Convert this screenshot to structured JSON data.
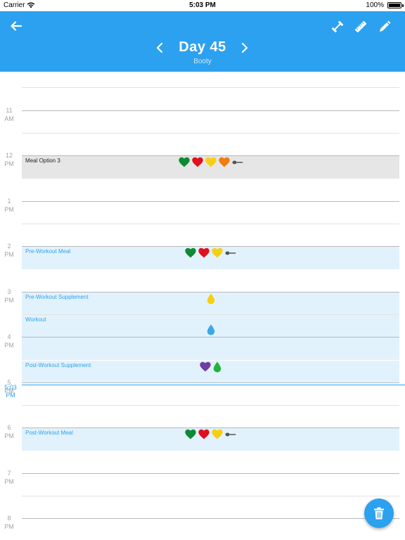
{
  "status_bar": {
    "carrier": "Carrier",
    "time": "5:03 PM",
    "battery": "100%"
  },
  "header": {
    "title": "Day 45",
    "subtitle": "Booty"
  },
  "timeline": {
    "hours": [
      {
        "num": "",
        "ampm": "AM"
      },
      {
        "num": "11",
        "ampm": "AM"
      },
      {
        "num": "12",
        "ampm": "PM"
      },
      {
        "num": "1",
        "ampm": "PM"
      },
      {
        "num": "2",
        "ampm": "PM"
      },
      {
        "num": "3",
        "ampm": "PM"
      },
      {
        "num": "4",
        "ampm": "PM"
      },
      {
        "num": "5",
        "ampm": "PM"
      },
      {
        "num": "6",
        "ampm": "PM"
      },
      {
        "num": "7",
        "ampm": "PM"
      },
      {
        "num": "8",
        "ampm": "PM"
      }
    ],
    "now": {
      "time": "5:03",
      "ampm": "PM"
    }
  },
  "events": [
    {
      "title": "Meal Option 3",
      "style": "gray",
      "icons": [
        "heart-green",
        "heart-red",
        "heart-yellow",
        "heart-orange",
        "spoon"
      ]
    },
    {
      "title": "Pre-Workout Meal",
      "style": "blue",
      "icons": [
        "heart-green",
        "heart-red",
        "heart-yellow",
        "spoon"
      ]
    },
    {
      "title": "Pre-Workout Supplement",
      "style": "blue",
      "icons": [
        "drop-yellow"
      ]
    },
    {
      "title": "Workout",
      "style": "blue",
      "icons": [
        "drop-blue"
      ]
    },
    {
      "title": "Post-Workout Supplement",
      "style": "blue",
      "icons": [
        "heart-purple",
        "drop-green"
      ]
    },
    {
      "title": "Post-Workout Meal",
      "style": "blue",
      "icons": [
        "heart-green",
        "heart-red",
        "heart-yellow",
        "spoon"
      ]
    }
  ],
  "colors": {
    "accent": "#2ca1ef",
    "heart-green": "#0f8a34",
    "heart-red": "#e0101f",
    "heart-yellow": "#f5cf14",
    "heart-orange": "#f07c12",
    "heart-purple": "#6e3fa3",
    "drop-yellow": "#f5cf14",
    "drop-blue": "#3ba7e8",
    "drop-green": "#20b43a",
    "spoon": "#555555"
  }
}
